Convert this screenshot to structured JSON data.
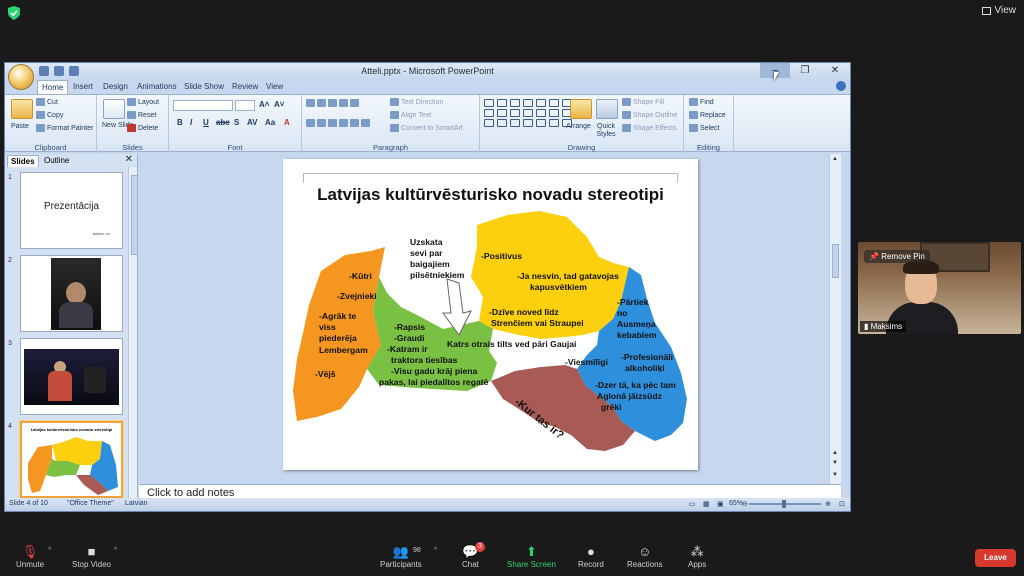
{
  "zoom": {
    "view_label": "View",
    "toolbar": {
      "unmute": "Unmute",
      "stop_video": "Stop Video",
      "participants": "Participants",
      "participants_count": "98",
      "chat": "Chat",
      "chat_badge": "3",
      "share_screen": "Share Screen",
      "record": "Record",
      "reactions": "Reactions",
      "apps": "Apps",
      "leave": "Leave"
    },
    "video_tile": {
      "pin_label": "Remove Pin",
      "name": "Maksims"
    },
    "colors": {
      "share_green": "#2ad36f",
      "leave_red": "#d8392f"
    }
  },
  "powerpoint": {
    "window_title": "Atteli.pptx - Microsoft PowerPoint",
    "tabs": [
      "Home",
      "Insert",
      "Design",
      "Animations",
      "Slide Show",
      "Review",
      "View"
    ],
    "ribbon": {
      "clipboard": {
        "label": "Clipboard",
        "paste": "Paste",
        "cut": "Cut",
        "copy": "Copy",
        "format_painter": "Format Painter"
      },
      "slides": {
        "label": "Slides",
        "new_slide": "New Slide",
        "layout": "Layout",
        "reset": "Reset",
        "delete": "Delete"
      },
      "font": {
        "label": "Font"
      },
      "paragraph": {
        "label": "Paragraph",
        "text_direction": "Text Direction",
        "align_text": "Align Text",
        "convert_smartart": "Convert to SmartArt"
      },
      "drawing": {
        "label": "Drawing",
        "arrange": "Arrange",
        "quick_styles": "Quick Styles",
        "shape_fill": "Shape Fill",
        "shape_outline": "Shape Outline",
        "shape_effects": "Shape Effects"
      },
      "editing": {
        "label": "Editing",
        "find": "Find",
        "replace": "Replace",
        "select": "Select"
      }
    },
    "panel_tabs": {
      "slides": "Slides",
      "outline": "Outline"
    },
    "thumbnails": [
      {
        "num": "1",
        "title": "Prezentācija",
        "subtitle": "autors: xx"
      },
      {
        "num": "2"
      },
      {
        "num": "3"
      },
      {
        "num": "4",
        "title": "Latvijas kultūrvēsturisko novadu stereotipi"
      }
    ],
    "slide": {
      "title": "Latvijas kultūrvēsturisko novadu stereotipi",
      "kurzeme": [
        "-Kūtri",
        "-Zvejnieki",
        "-Agrāk te",
        "viss",
        "piederēja",
        "Lembergam",
        "-Vējš"
      ],
      "riga_note": [
        "Uzskata",
        "sevi par",
        "baigajiem",
        "pilsētniekiem"
      ],
      "vidzeme": [
        "-Positivus",
        "-Ja nesvin, tad gatavojas",
        "kapusvētkiem",
        "-Dzīve noved līdz",
        "Strenčiem vai Straupei"
      ],
      "zemgale": [
        "-Rapsis",
        "-Graudi",
        "-Katram ir",
        "traktora tiesības",
        "-Visu gadu krāj piena",
        "pakas, lai piedalītos regatē"
      ],
      "center_note": "Katrs otrais tilts ved pāri Gaujai",
      "latgale": [
        "-Pārtiek",
        "no",
        "Ausmeņa",
        "kebabiem",
        "-Profesionāli",
        "alkoholiķi",
        "-Viesmīlīgi",
        "-Dzer tā, ka pēc tam",
        "Aglonā jāizsūdz",
        "grēki"
      ],
      "selija": "-Kur tas ir?",
      "colors": {
        "kurzeme": "#f59620",
        "vidzeme": "#fcd00f",
        "zemgale": "#7ac143",
        "latgale": "#2e8fdc",
        "selija": "#a85a55"
      }
    },
    "notes_placeholder": "Click to add notes",
    "status": {
      "slide_of": "Slide 4 of 10",
      "theme": "\"Office Theme\"",
      "language": "Latvian",
      "zoom_level": "65%"
    }
  }
}
